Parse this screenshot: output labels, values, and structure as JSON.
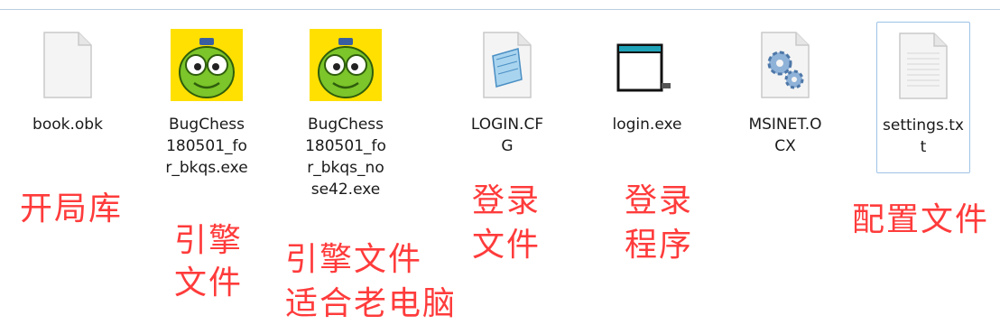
{
  "files": [
    {
      "name": "book.obk",
      "icon": "blank-document-icon"
    },
    {
      "name": "BugChess180501_for_bkqs.exe",
      "icon": "bug-chess-app-icon"
    },
    {
      "name": "BugChess180501_for_bkqs_nose42.exe",
      "icon": "bug-chess-app-icon"
    },
    {
      "name": "LOGIN.CFG",
      "icon": "notepad-icon"
    },
    {
      "name": "login.exe",
      "icon": "generic-exe-icon"
    },
    {
      "name": "MSINET.OCX",
      "icon": "gear-component-icon"
    },
    {
      "name": "settings.txt",
      "icon": "text-document-icon"
    }
  ],
  "annotations": {
    "a1": "开局库",
    "a2_l1": "引擎",
    "a2_l2": "文件",
    "a3_l1": "引擎文件",
    "a3_l2": "适合老电脑",
    "a4_l1": "登录",
    "a4_l2": "文件",
    "a5_l1": "登录",
    "a5_l2": "程序",
    "a6": "配置文件"
  },
  "colors": {
    "annotation": "#ff3b3b",
    "selection_border": "#9ec3e6"
  }
}
